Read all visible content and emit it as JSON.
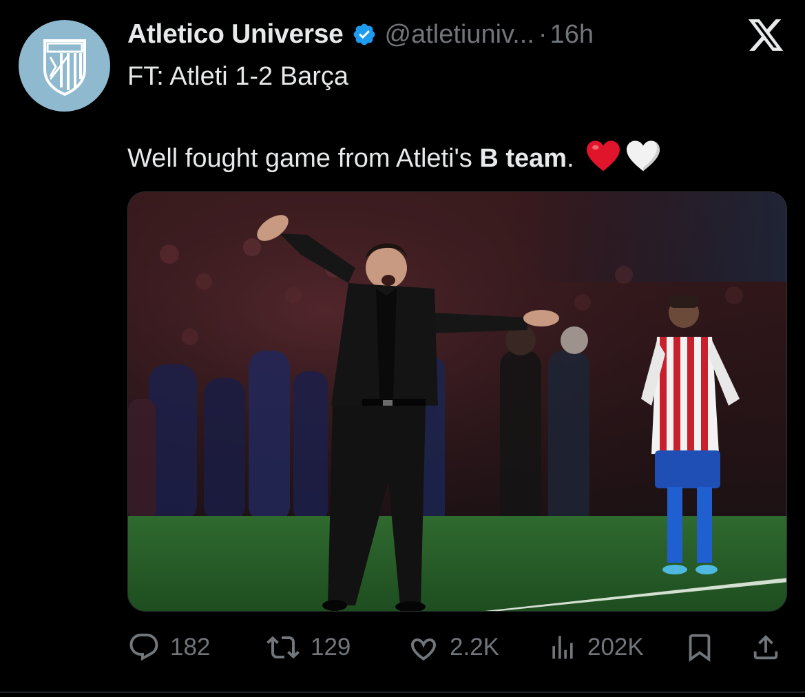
{
  "author": {
    "display_name": "Atletico Universe",
    "handle": "@atletiuniv...",
    "separator": "·",
    "time": "16h",
    "verified": true,
    "avatar_icon": "atletico-crest-icon",
    "avatar_color": "#8fb9cf"
  },
  "tweet": {
    "line1": "FT: Atleti 1-2 Barça",
    "line2_prefix": "Well fought game from Atleti's ",
    "line2_bold": "B team",
    "line2_suffix": ".",
    "emojis": [
      "red-heart-icon",
      "white-heart-icon"
    ]
  },
  "media": {
    "icon": "photo",
    "description_icon": "coach-on-sideline-photo"
  },
  "actions": {
    "replies": "182",
    "reposts": "129",
    "likes": "2.2K",
    "views": "202K"
  },
  "colors": {
    "background": "#000000",
    "text": "#e7e9ea",
    "secondary": "#71767b",
    "verified": "#1d9bf0",
    "heart_red": "#e0142a"
  },
  "brand_icon": "x-logo-icon"
}
